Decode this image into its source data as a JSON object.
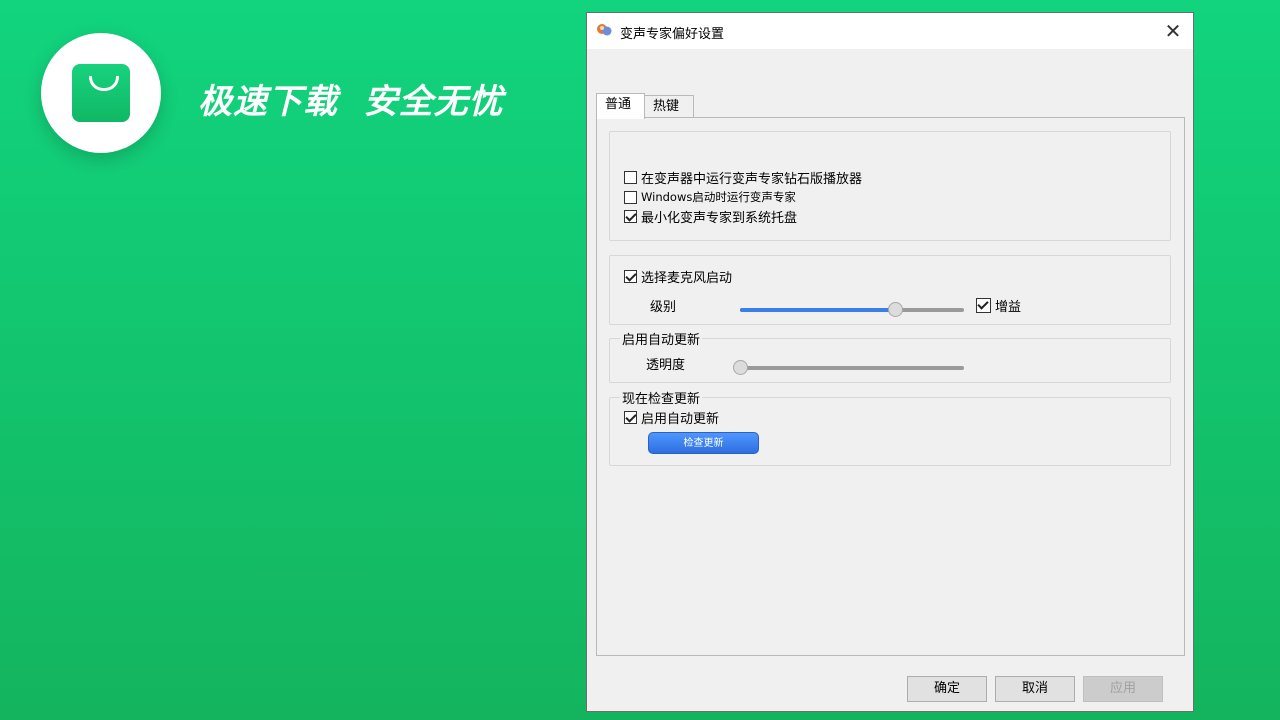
{
  "banner": {
    "slogan": "极速下载  安全无忧",
    "icon": "shopping-bag-icon"
  },
  "dialog": {
    "title": "变声专家偏好设置",
    "close_glyph": "✕",
    "tabs": [
      {
        "label": "普通",
        "active": true
      },
      {
        "label": "热键",
        "active": false
      }
    ],
    "general": {
      "options": [
        {
          "label": "在变声器中运行变声专家钻石版播放器",
          "checked": false
        },
        {
          "label": "Windows启动时运行变声专家",
          "checked": false
        },
        {
          "label": "最小化变声专家到系统托盘",
          "checked": true
        }
      ]
    },
    "mic": {
      "enable_label": "选择麦克风启动",
      "enable_checked": true,
      "level_label": "级别",
      "level_value": 0.69,
      "gain_label": "增益",
      "gain_checked": true
    },
    "auto_update": {
      "group_label": "启用自动更新",
      "transparency_label": "透明度",
      "transparency_value": 0.0
    },
    "check_update": {
      "group_label": "现在检查更新",
      "enable_label": "启用自动更新",
      "enable_checked": true,
      "button_label": "检查更新"
    },
    "footer": {
      "ok_label": "确定",
      "cancel_label": "取消",
      "apply_label": "应用"
    }
  },
  "colors": {
    "background_top": "#12d47e",
    "background_bottom": "#14b45e",
    "accent_blue": "#3a7ee8"
  }
}
